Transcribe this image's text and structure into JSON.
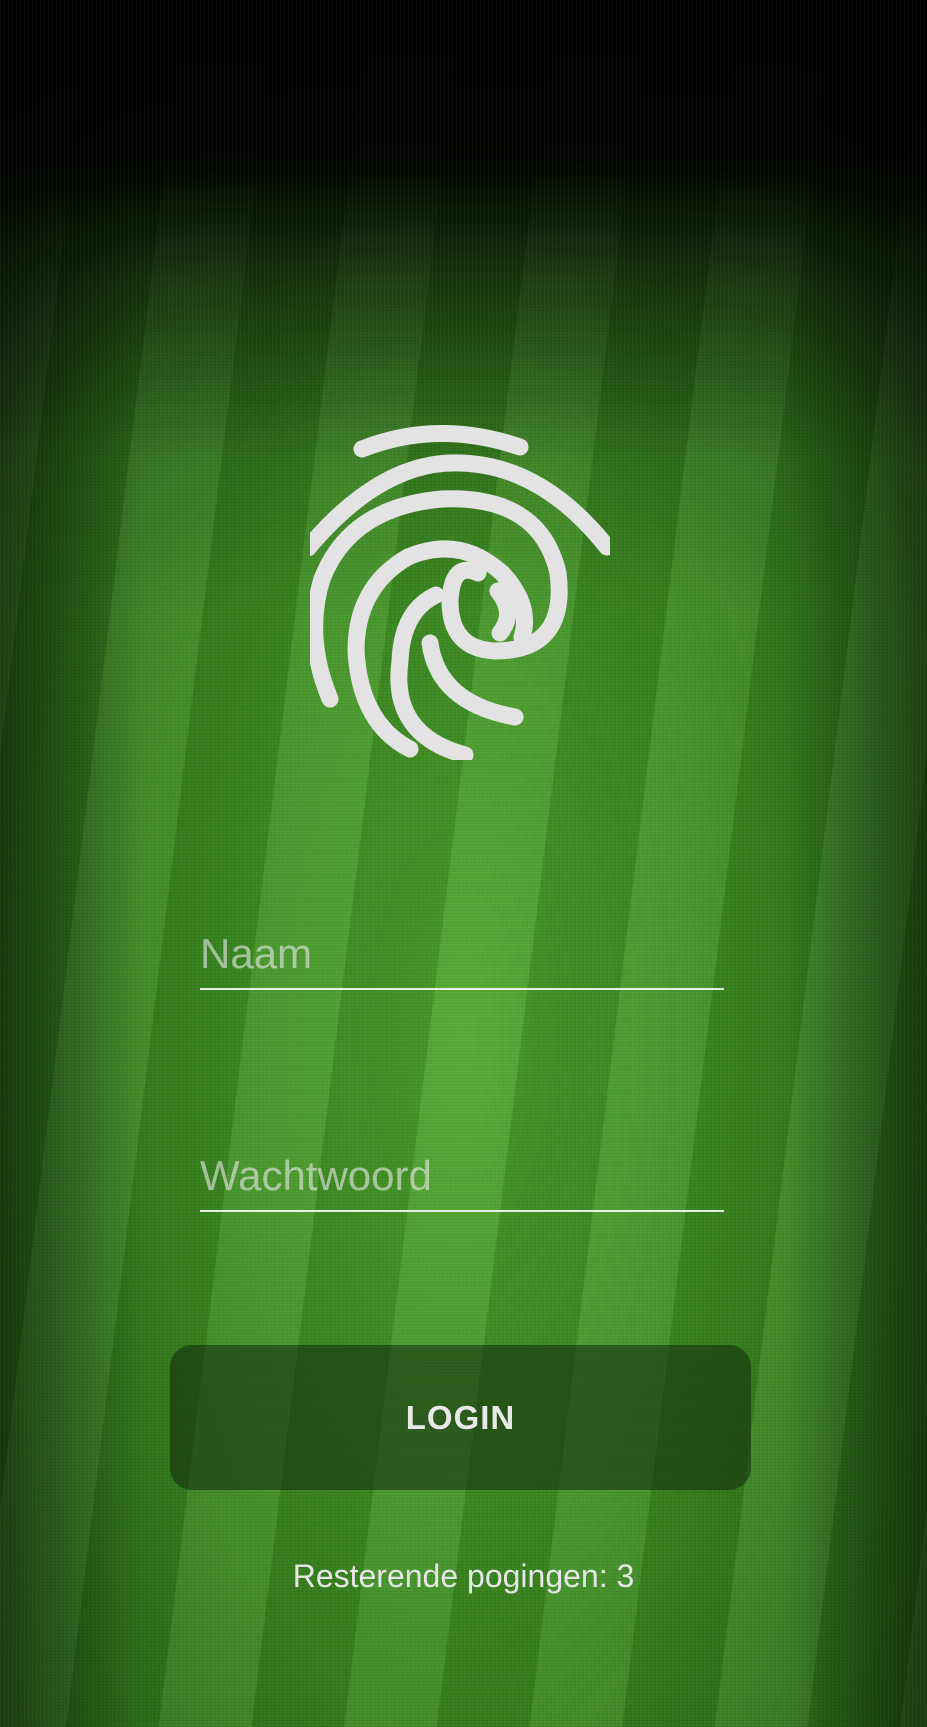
{
  "login": {
    "name_placeholder": "Naam",
    "name_value": "",
    "password_placeholder": "Wachtwoord",
    "password_value": "",
    "button_label": "LOGIN",
    "attempts_text": "Resterende pogingen: 3"
  },
  "icons": {
    "fingerprint": "fingerprint-icon"
  },
  "colors": {
    "text": "#e6e6e6",
    "grass": "#3d8f22",
    "button_bg": "#12280c"
  }
}
